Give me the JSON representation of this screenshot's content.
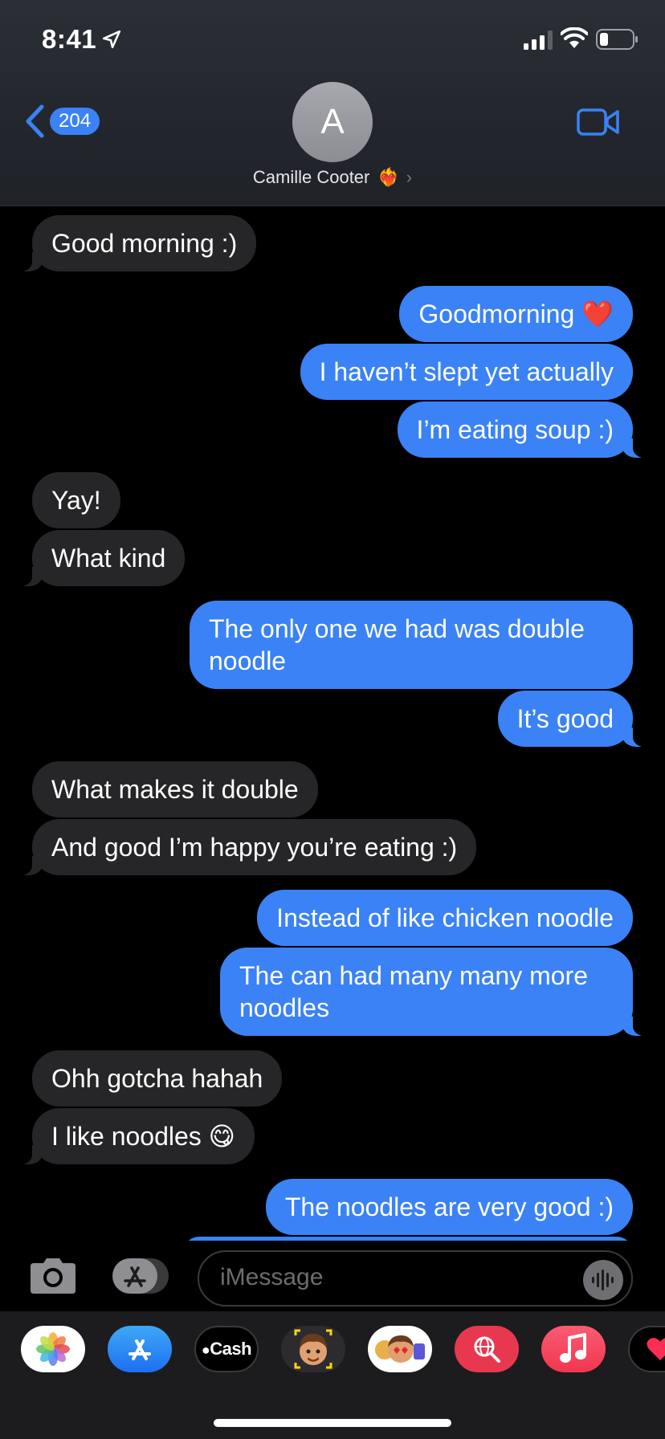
{
  "status_bar": {
    "time": "8:41"
  },
  "header": {
    "back_count": "204",
    "avatar_letter": "A",
    "contact_name": "Camille Cooter",
    "contact_emoji": "❤️‍🔥"
  },
  "messages": [
    {
      "side": "in",
      "text": "Good morning :)"
    },
    {
      "side": "out",
      "text": "Goodmorning ❤️"
    },
    {
      "side": "out",
      "text": "I haven’t slept yet actually"
    },
    {
      "side": "out",
      "text": "I’m eating soup :)"
    },
    {
      "side": "in",
      "text": "Yay!"
    },
    {
      "side": "in",
      "text": "What kind"
    },
    {
      "side": "out",
      "text": "The only one we had was double noodle"
    },
    {
      "side": "out",
      "text": "It’s good"
    },
    {
      "side": "in",
      "text": "What makes it double"
    },
    {
      "side": "in",
      "text": "And good I’m happy you’re eating :)"
    },
    {
      "side": "out",
      "text": "Instead of like chicken noodle"
    },
    {
      "side": "out",
      "text": "The can had many many more noodles"
    },
    {
      "side": "in",
      "text": "Ohh gotcha hahah"
    },
    {
      "side": "in",
      "text": "I like noodles 😋"
    },
    {
      "side": "out",
      "text": "The noodles are very good :)"
    }
  ],
  "composer": {
    "placeholder": "iMessage"
  },
  "app_drawer": {
    "apps": [
      {
        "name": "photos-app",
        "icon": "photos-icon"
      },
      {
        "name": "app-store-app",
        "icon": "app-store-icon"
      },
      {
        "name": "apple-cash-app",
        "icon": "apple-cash-icon",
        "label": "Cash"
      },
      {
        "name": "memoji-app",
        "icon": "memoji-icon"
      },
      {
        "name": "memoji-stickers-app",
        "icon": "memoji-stickers-icon"
      },
      {
        "name": "image-search-app",
        "icon": "globe-search-icon"
      },
      {
        "name": "music-app",
        "icon": "music-icon"
      },
      {
        "name": "digital-touch-app",
        "icon": "digital-touch-icon"
      }
    ]
  },
  "colors": {
    "accent_blue": "#3a82f6",
    "incoming_bubble": "#262628",
    "background": "#000000"
  }
}
